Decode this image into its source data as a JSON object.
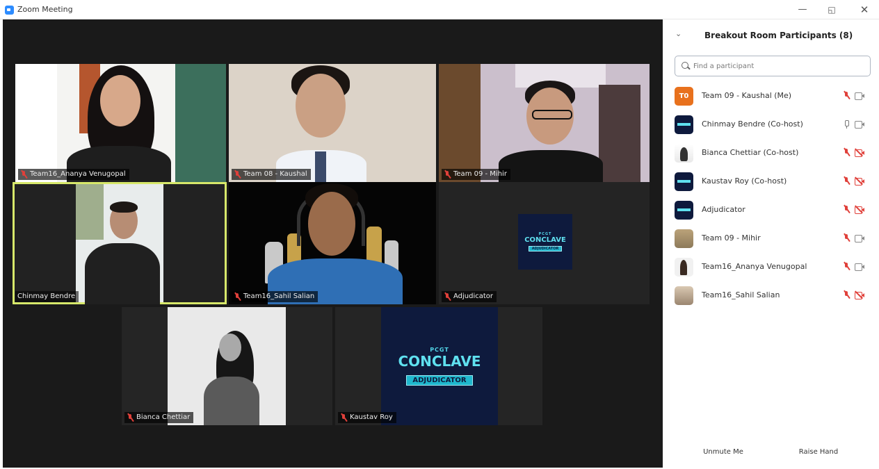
{
  "window": {
    "title": "Zoom Meeting",
    "minimize": "—",
    "maximize": "◱",
    "close": "✕"
  },
  "tiles": [
    {
      "name": "Team16_Ananya Venugopal",
      "muted": true
    },
    {
      "name": "Team 08 - Kaushal",
      "muted": true
    },
    {
      "name": "Team 09 - Mihir",
      "muted": true
    },
    {
      "name": "Chinmay Bendre",
      "muted": false,
      "active": true
    },
    {
      "name": "Team16_Sahil Salian",
      "muted": true
    },
    {
      "name": "Adjudicator",
      "muted": true
    },
    {
      "name": "Bianca Chettiar",
      "muted": true
    },
    {
      "name": "Kaustav Roy",
      "muted": true
    }
  ],
  "logo": {
    "pcgt": "PCGT",
    "conclave": "CONCLAVE",
    "badge": "ADJUDICATOR"
  },
  "panel": {
    "title": "Breakout Room Participants (8)",
    "search_placeholder": "Find a participant",
    "participants": [
      {
        "name": "Team 09 - Kaushal (Me)",
        "avatar": "initials",
        "initials": "T0",
        "mic": "muted",
        "cam": "on"
      },
      {
        "name": "Chinmay Bendre (Co-host)",
        "avatar": "logo",
        "mic": "on",
        "cam": "on"
      },
      {
        "name": "Bianca Chettiar (Co-host)",
        "avatar": "photo1",
        "mic": "muted",
        "cam": "off"
      },
      {
        "name": "Kaustav Roy (Co-host)",
        "avatar": "logo",
        "mic": "muted",
        "cam": "off"
      },
      {
        "name": "Adjudicator",
        "avatar": "logo",
        "mic": "muted",
        "cam": "off"
      },
      {
        "name": "Team 09 - Mihir",
        "avatar": "photo2",
        "mic": "muted",
        "cam": "on"
      },
      {
        "name": "Team16_Ananya Venugopal",
        "avatar": "photo3",
        "mic": "muted",
        "cam": "on"
      },
      {
        "name": "Team16_Sahil Salian",
        "avatar": "photo4",
        "mic": "muted",
        "cam": "off"
      }
    ],
    "unmute_label": "Unmute Me",
    "raise_hand_label": "Raise Hand"
  },
  "colors": {
    "active_speaker": "#d7e86a",
    "muted_red": "#e0403a",
    "logo_bg": "#0e1a3d",
    "logo_cyan": "#5fe0ef"
  }
}
